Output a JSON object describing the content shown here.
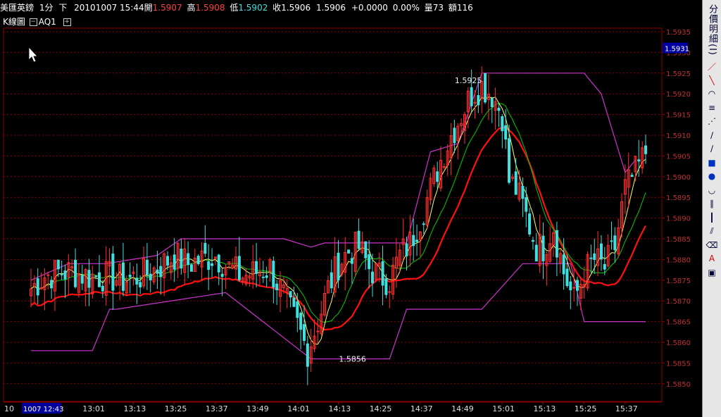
{
  "header": {
    "symbol": "美匯英鎊",
    "period": "1分",
    "dir": "下",
    "datetime": "20101007 15:44",
    "open_label": "開",
    "open": "1.5907",
    "high_label": "高",
    "high": "1.5908",
    "low_label": "低",
    "low": "1.5902",
    "close_label": "收",
    "close": "1.5906",
    "last": "1.5906",
    "change": "+0.0000",
    "change_pct": "0.00%",
    "vol_label": "量",
    "vol": "73",
    "amt_label": "額",
    "amt": "116"
  },
  "subbar": {
    "kline_label": "K線圖",
    "indicator": "AQ1"
  },
  "sidebar": {
    "title": "分價明細(I)",
    "tools": [
      "line-tool-icon",
      "ray-tool-icon",
      "fan-arc-icon",
      "multi-line-icon",
      "speed-line-icon",
      "fan-line-icon",
      "fan-line2-icon",
      "rectangle-icon",
      "ellipse-icon",
      "fib-arc-icon",
      "parallel-line-icon",
      "cycle-line-icon",
      "channel-icon",
      "eraser-icon",
      "text-icon",
      "clear-icon"
    ]
  },
  "colors": {
    "bg": "#000000",
    "grid": "#8b0000",
    "candle_up": "#ff3030",
    "candle_down": "#40e0e0",
    "ma_thick": "#ff1010",
    "ma_green": "#00cc00",
    "ma_yellow": "#ffff66",
    "envelope": "#cc33cc"
  },
  "chart_data": {
    "type": "candlestick",
    "yaxis": {
      "ticks": [
        "1.5935",
        "1.5930",
        "1.5925",
        "1.5920",
        "1.5915",
        "1.5910",
        "1.5905",
        "1.5900",
        "1.5895",
        "1.5890",
        "1.5885",
        "1.5880",
        "1.5875",
        "1.5870",
        "1.5865",
        "1.5860",
        "1.5855",
        "1.5850"
      ],
      "range": [
        1.5845,
        1.5935
      ],
      "current": "1.5931"
    },
    "xaxis": {
      "first_tick": "10",
      "current": "1007 12:43",
      "ticks": [
        "13:01",
        "13:13",
        "13:25",
        "13:37",
        "13:49",
        "14:01",
        "14:13",
        "14:25",
        "14:37",
        "14:49",
        "15:01",
        "15:13",
        "15:25",
        "15:37"
      ]
    },
    "annotations": [
      {
        "text": "1.5925",
        "x": "14:57",
        "y": 1.5925
      },
      {
        "text": "1.5856",
        "x": "14:07",
        "y": 1.5856
      }
    ],
    "approx_close_path": [
      [
        "12:43",
        1.5873
      ],
      [
        "12:47",
        1.5876
      ],
      [
        "12:51",
        1.5877
      ],
      [
        "12:55",
        1.5877
      ],
      [
        "13:00",
        1.5876
      ],
      [
        "13:05",
        1.5876
      ],
      [
        "13:10",
        1.5875
      ],
      [
        "13:15",
        1.5876
      ],
      [
        "13:20",
        1.5878
      ],
      [
        "13:25",
        1.5881
      ],
      [
        "13:29",
        1.5879
      ],
      [
        "13:33",
        1.588
      ],
      [
        "13:37",
        1.5881
      ],
      [
        "13:41",
        1.5878
      ],
      [
        "13:45",
        1.5876
      ],
      [
        "13:49",
        1.5877
      ],
      [
        "13:53",
        1.5878
      ],
      [
        "13:57",
        1.5871
      ],
      [
        "14:01",
        1.5864
      ],
      [
        "14:04",
        1.5858
      ],
      [
        "14:07",
        1.5865
      ],
      [
        "14:10",
        1.5873
      ],
      [
        "14:13",
        1.5879
      ],
      [
        "14:16",
        1.5882
      ],
      [
        "14:19",
        1.5883
      ],
      [
        "14:22",
        1.5878
      ],
      [
        "14:25",
        1.5876
      ],
      [
        "14:28",
        1.5875
      ],
      [
        "14:31",
        1.5881
      ],
      [
        "14:34",
        1.5884
      ],
      [
        "14:37",
        1.589
      ],
      [
        "14:40",
        1.5897
      ],
      [
        "14:43",
        1.5904
      ],
      [
        "14:46",
        1.591
      ],
      [
        "14:49",
        1.5915
      ],
      [
        "14:52",
        1.592
      ],
      [
        "14:55",
        1.5922
      ],
      [
        "14:58",
        1.592
      ],
      [
        "15:01",
        1.5915
      ],
      [
        "15:03",
        1.5899
      ],
      [
        "15:05",
        1.5897
      ],
      [
        "15:07",
        1.5893
      ],
      [
        "15:09",
        1.5888
      ],
      [
        "15:11",
        1.5883
      ],
      [
        "15:13",
        1.5883
      ],
      [
        "15:16",
        1.5888
      ],
      [
        "15:19",
        1.5877
      ],
      [
        "15:22",
        1.587
      ],
      [
        "15:25",
        1.5877
      ],
      [
        "15:28",
        1.588
      ],
      [
        "15:31",
        1.5878
      ],
      [
        "15:34",
        1.5883
      ],
      [
        "15:37",
        1.5897
      ],
      [
        "15:40",
        1.5901
      ],
      [
        "15:43",
        1.5906
      ]
    ],
    "lines": [
      {
        "name": "upper-envelope",
        "points": [
          [
            "12:43",
            1.5875
          ],
          [
            "12:54",
            1.5879
          ],
          [
            "13:05",
            1.5879
          ],
          [
            "13:20",
            1.5881
          ],
          [
            "13:27",
            1.5885
          ],
          [
            "13:57",
            1.5885
          ],
          [
            "14:05",
            1.5883
          ],
          [
            "14:09",
            1.5884
          ],
          [
            "14:33",
            1.5884
          ],
          [
            "14:40",
            1.5906
          ],
          [
            "14:48",
            1.5908
          ],
          [
            "14:55",
            1.5925
          ],
          [
            "15:25",
            1.5925
          ],
          [
            "15:26",
            1.5924
          ],
          [
            "15:30",
            1.592
          ],
          [
            "15:37",
            1.5901
          ],
          [
            "15:40",
            1.5904
          ]
        ]
      },
      {
        "name": "lower-envelope",
        "points": [
          [
            "12:43",
            1.5858
          ],
          [
            "13:01",
            1.5858
          ],
          [
            "13:06",
            1.5868
          ],
          [
            "13:08",
            1.5868
          ],
          [
            "13:40",
            1.5872
          ],
          [
            "14:05",
            1.5856
          ],
          [
            "14:28",
            1.5856
          ],
          [
            "14:33",
            1.5868
          ],
          [
            "14:55",
            1.5868
          ],
          [
            "15:07",
            1.5879
          ],
          [
            "15:21",
            1.5879
          ],
          [
            "15:25",
            1.5865
          ],
          [
            "15:43",
            1.5865
          ]
        ]
      }
    ]
  }
}
